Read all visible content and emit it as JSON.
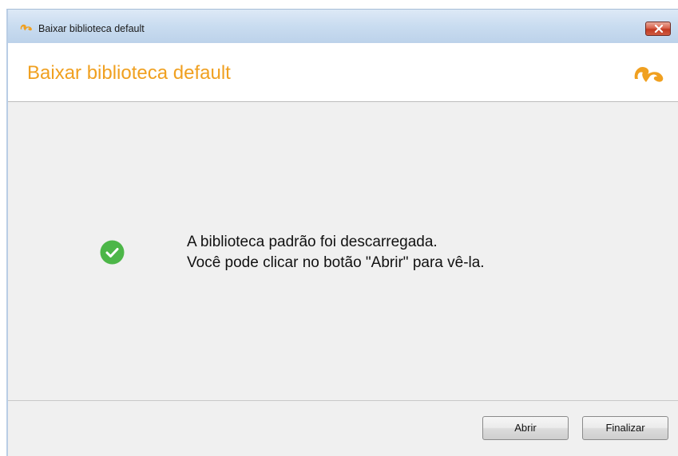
{
  "window": {
    "title": "Baixar biblioteca default",
    "app_icon": "seaside-logo-icon",
    "close_icon": "close-icon"
  },
  "header": {
    "title": "Baixar biblioteca default",
    "logo_icon": "seaside-logo-icon"
  },
  "content": {
    "status_icon": "checkmark-circle-icon",
    "message_line1": "A biblioteca padrão foi descarregada.",
    "message_line2": "Você pode clicar no botão \"Abrir\" para vê-la."
  },
  "footer": {
    "open_label": "Abrir",
    "finish_label": "Finalizar"
  },
  "colors": {
    "accent": "#f0a020",
    "success": "#4cb648",
    "close_button": "#c94530"
  }
}
